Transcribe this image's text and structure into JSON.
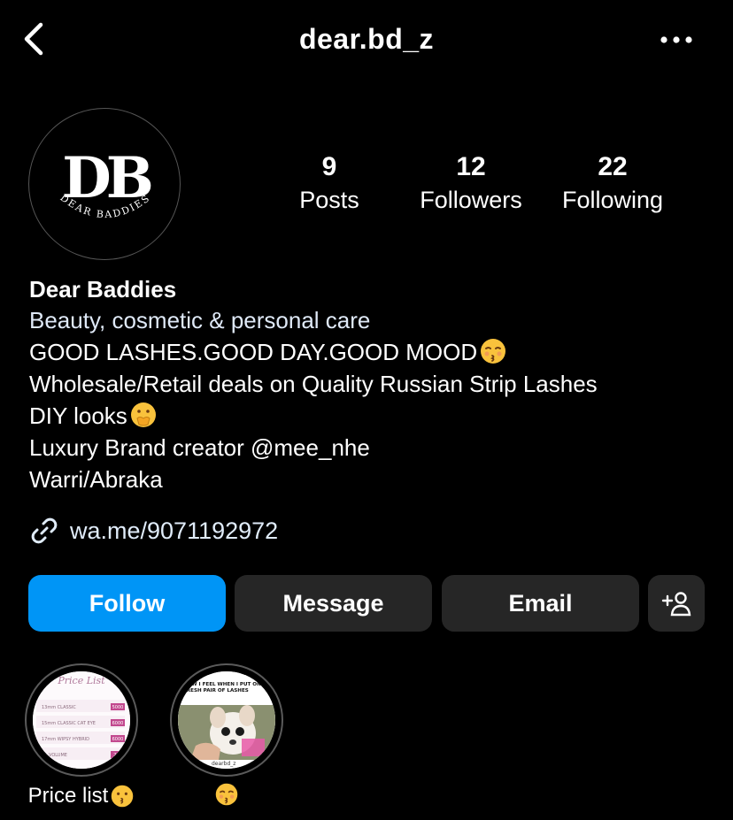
{
  "header": {
    "username": "dear.bd_z",
    "back_icon": "chevron-left-icon",
    "more_icon": "more-horizontal-icon"
  },
  "profile": {
    "avatar_logo": "DB",
    "avatar_text": "DEAR BADDIES",
    "stats": [
      {
        "value": "9",
        "label": "Posts"
      },
      {
        "value": "12",
        "label": "Followers"
      },
      {
        "value": "22",
        "label": "Following"
      }
    ]
  },
  "bio": {
    "name": "Dear Baddies",
    "category": "Beauty, cosmetic & personal care",
    "line1": "GOOD LASHES.GOOD DAY.GOOD MOOD",
    "line2": "Wholesale/Retail deals on Quality Russian Strip Lashes",
    "line3": "DIY looks",
    "line4": "Luxury Brand creator @mee_nhe",
    "line5": "Warri/Abraka",
    "link": "wa.me/9071192972"
  },
  "actions": {
    "follow": "Follow",
    "message": "Message",
    "email": "Email",
    "add_user_icon": "add-user-icon"
  },
  "highlights": [
    {
      "label": "Price list",
      "title": "Price List",
      "rows": [
        {
          "name": "13mm CLASSIC",
          "price": "5000"
        },
        {
          "name": "15mm CLASSIC CAT EYE",
          "price": "6000"
        },
        {
          "name": "17mm WIPSY HYBRID",
          "price": "6000"
        },
        {
          "name": "VOLUME",
          "price": "200"
        }
      ]
    },
    {
      "label": "",
      "caption": "HOW I FEEL WHEN I PUT ON A FRESH PAIR OF LASHES",
      "watermark": "dearbd_z"
    }
  ],
  "colors": {
    "accent": "#0095f6",
    "button_bg": "#262626",
    "background": "#000000"
  }
}
